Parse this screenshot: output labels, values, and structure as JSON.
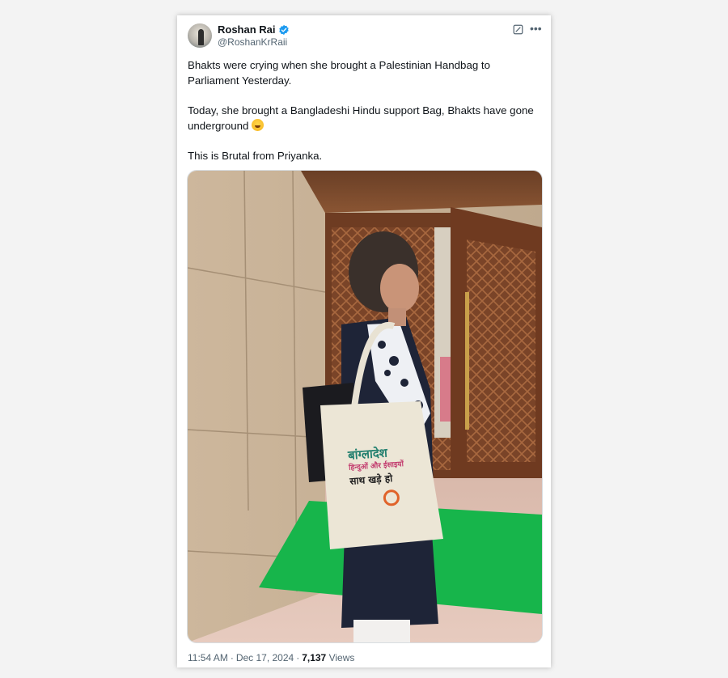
{
  "post": {
    "author": {
      "display_name": "Roshan Rai",
      "handle": "@RoshanKrRaii",
      "verified": true,
      "avatar_icon": "avatar-silhouette"
    },
    "text_paragraphs": [
      "Bhakts were crying when she brought a Palestinian Handbag to Parliament Yesterday.",
      "Today, she brought a Bangladeshi Hindu support Bag, Bhakts have gone underground",
      "This is Brutal from Priyanka."
    ],
    "emoji": "face-with-tears-of-joy",
    "media": {
      "bag_text_line1": "बांग्लादेश",
      "bag_text_line2": "हिन्दुओं और ईसाइयों",
      "bag_text_line3": "साथ खड़े हो"
    },
    "timestamp": {
      "time": "11:54 AM",
      "separator": "·",
      "date": "Dec 17, 2024",
      "views_count": "7,137",
      "views_label": "Views"
    },
    "icons": {
      "verified": "verified-badge-icon",
      "grok": "grok-icon",
      "more": "more-icon"
    },
    "colors": {
      "verified": "#1d9bf0",
      "text_primary": "#0f1419",
      "text_secondary": "#536471"
    }
  }
}
